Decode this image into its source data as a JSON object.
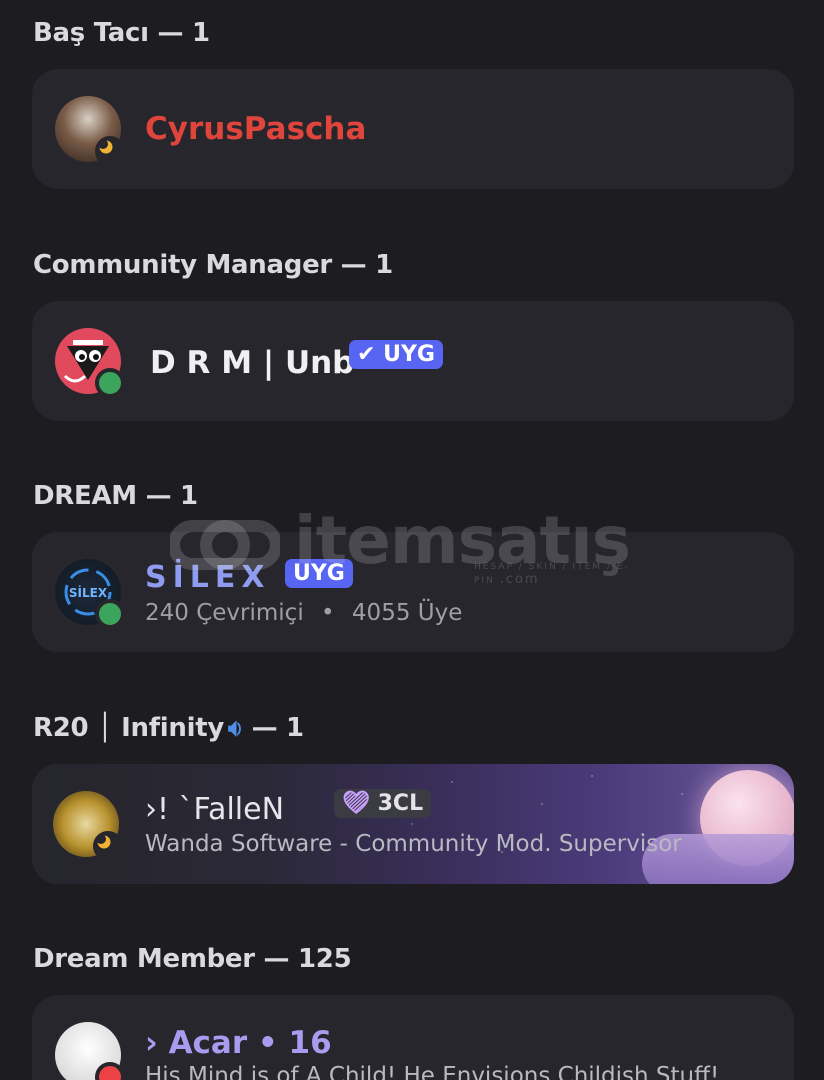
{
  "sections": [
    {
      "header": "Baş Tacı — 1",
      "member": {
        "name": "CyrusPascha",
        "name_color": "#e0453c",
        "status": "idle"
      }
    },
    {
      "header": "Community Manager — 1",
      "member": {
        "name": "D R M | Unb",
        "name_color": "#f0f0f2",
        "status": "online",
        "tag": "✔ UYG"
      }
    },
    {
      "header": "DREAM — 1",
      "member": {
        "name": "SİLEX",
        "name_color": "#8f9bf0",
        "status": "online",
        "tag": "UYG",
        "sub_online": "240 Çevrimiçi",
        "sub_sep": "•",
        "sub_members": "4055 Üye"
      }
    },
    {
      "header": "R20 │ Infinity",
      "header_count": "— 1",
      "header_icon": "speaker-icon",
      "member": {
        "name": "›!  `FalleN",
        "name_color": "#e6e6ea",
        "status": "idle",
        "tag": "3CL",
        "tag_icon": "heart-icon",
        "sub": "Wanda Software - Community Mod. Supervisor"
      }
    },
    {
      "header": "Dream Member — 125",
      "member": {
        "name": "› Acar • 16",
        "name_color": "#a99cf0",
        "status": "dnd",
        "sub": "His Mind is of A Child! He Envisions Childish Stuff!"
      }
    }
  ],
  "watermark": {
    "text": "itemsatış",
    "tagline": "HESAP / SKIN / ITEM / E-PIN",
    "suffix": ".com"
  }
}
